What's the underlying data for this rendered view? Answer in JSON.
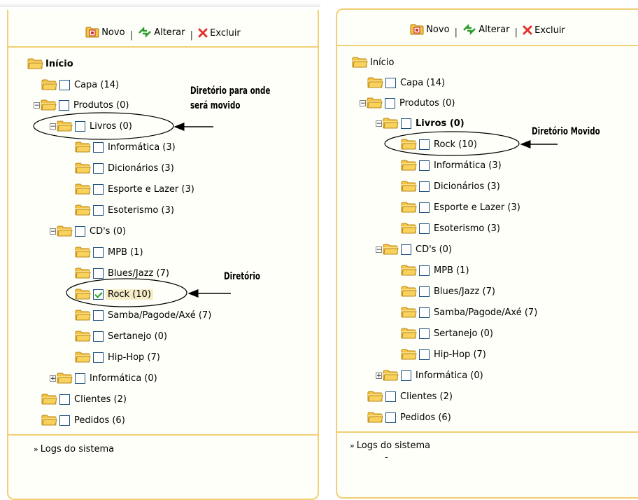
{
  "toolbar": {
    "novo_label": "Novo",
    "separator": "|",
    "alterar_label": "Alterar",
    "excluir_label": "Excluir"
  },
  "icons": {
    "novo": "new-folder-icon",
    "alterar": "arrows-icon",
    "excluir": "red-x-icon",
    "folder": "folder-icon",
    "expand": "plus-box-icon",
    "collapse": "minus-box-icon"
  },
  "colors": {
    "border": "#f2cf74",
    "folder": "#f6c343",
    "checkbox_border": "#1c5180",
    "checkmark": "#21a121",
    "excluir_x": "#e03030",
    "highlight": "#f5ecc8"
  },
  "left_tree": {
    "root": "Início",
    "capa": "Capa (14)",
    "produtos": "Produtos (0)",
    "livros": "Livros (0)",
    "livros_children": [
      "Informática (3)",
      "Dicionários (3)",
      "Esporte e Lazer (3)",
      "Esoterismo (3)"
    ],
    "cds": "CD's (0)",
    "cds_children": [
      "MPB (1)",
      "Blues/Jazz (7)",
      "Rock (10)",
      "Samba/Pagode/Axé (7)",
      "Sertanejo (0)",
      "Hip-Hop (7)"
    ],
    "informatica": "Informática (0)",
    "clientes": "Clientes (2)",
    "pedidos": "Pedidos (6)"
  },
  "right_tree": {
    "root": "Início",
    "capa": "Capa (14)",
    "produtos": "Produtos (0)",
    "livros": "Livros (0)",
    "livros_children": [
      "Rock (10)",
      "Informática (3)",
      "Dicionários (3)",
      "Esporte e Lazer (3)",
      "Esoterismo (3)"
    ],
    "cds": "CD's (0)",
    "cds_children": [
      "MPB (1)",
      "Blues/Jazz (7)",
      "Samba/Pagode/Axé (7)",
      "Sertanejo (0)",
      "Hip-Hop (7)"
    ],
    "informatica": "Informática (0)",
    "clientes": "Clientes (2)",
    "pedidos": "Pedidos (6)"
  },
  "logs_label": "Logs do sistema",
  "logs_raquo": "»",
  "right_dash": "-",
  "annotations": {
    "destination_line1": "Diretório para onde",
    "destination_line2": "será movido",
    "source": "Diretório",
    "moved": "Diretório Movido"
  }
}
